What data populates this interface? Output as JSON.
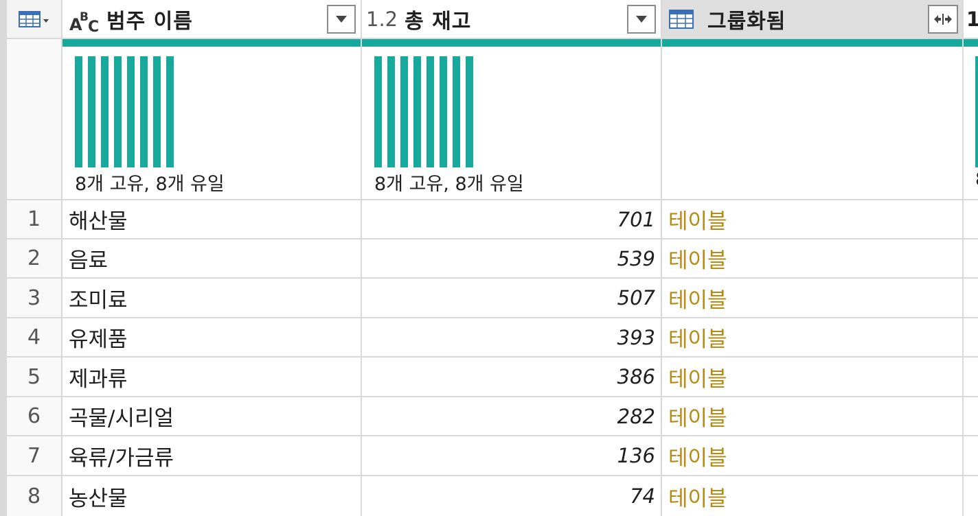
{
  "columns": {
    "category": {
      "type_label": "ABC",
      "title": "범주 이름",
      "distinct_text": "8개 고유, 8개 유일"
    },
    "stock": {
      "type_label": "1.2",
      "title": "총 재고",
      "distinct_text": "8개 고유, 8개 유일"
    },
    "grouped": {
      "title": "그룹화됨"
    },
    "next_partial": {
      "header_fragment": "1",
      "profile_fragment": "8"
    }
  },
  "rows": [
    {
      "num": "1",
      "category": "해산물",
      "stock": "701",
      "grouped": "테이블"
    },
    {
      "num": "2",
      "category": "음료",
      "stock": "539",
      "grouped": "테이블"
    },
    {
      "num": "3",
      "category": "조미료",
      "stock": "507",
      "grouped": "테이블"
    },
    {
      "num": "4",
      "category": "유제품",
      "stock": "393",
      "grouped": "테이블"
    },
    {
      "num": "5",
      "category": "제과류",
      "stock": "386",
      "grouped": "테이블"
    },
    {
      "num": "6",
      "category": "곡물/시리얼",
      "stock": "282",
      "grouped": "테이블"
    },
    {
      "num": "7",
      "category": "육류/가금류",
      "stock": "136",
      "grouped": "테이블"
    },
    {
      "num": "8",
      "category": "농산물",
      "stock": "74",
      "grouped": "테이블"
    }
  ],
  "colors": {
    "profile_teal": "#17a99b",
    "table_link": "#b78a14"
  }
}
